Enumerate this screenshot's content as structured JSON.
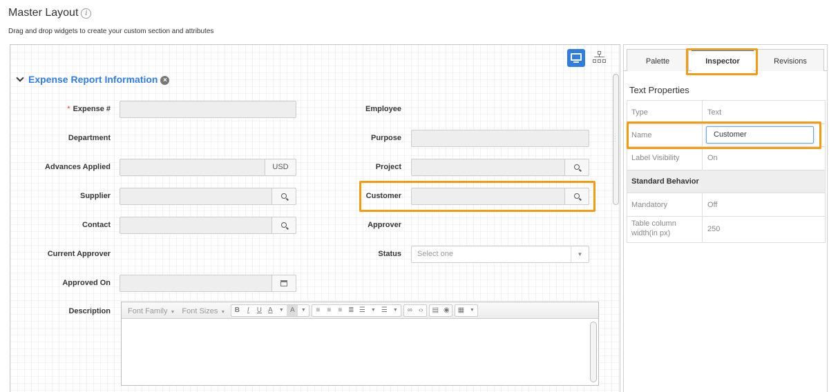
{
  "header": {
    "title": "Master Layout",
    "info_icon": "i",
    "subtitle": "Drag and drop widgets to create your custom section and attributes"
  },
  "canvas": {
    "view_toggles": [
      "desktop-icon",
      "hierarchy-icon"
    ],
    "section": {
      "title": "Expense Report Information",
      "remove_icon": "×"
    },
    "fields": {
      "expense": {
        "label": "Expense #",
        "required_mark": "*"
      },
      "employee": {
        "label": "Employee"
      },
      "department": {
        "label": "Department"
      },
      "purpose": {
        "label": "Purpose"
      },
      "advances": {
        "label": "Advances Applied",
        "addon": "USD"
      },
      "project": {
        "label": "Project"
      },
      "supplier": {
        "label": "Supplier"
      },
      "customer": {
        "label": "Customer"
      },
      "contact": {
        "label": "Contact"
      },
      "approver": {
        "label": "Approver"
      },
      "current_approver": {
        "label": "Current Approver"
      },
      "status": {
        "label": "Status",
        "placeholder": "Select one"
      },
      "approved_on": {
        "label": "Approved On"
      },
      "description": {
        "label": "Description"
      }
    },
    "editor_toolbar": {
      "font_family": "Font Family",
      "font_sizes": "Font Sizes",
      "bold": "B",
      "italic": "I",
      "underline": "U",
      "font_color": "A",
      "bg_color": "A"
    }
  },
  "panel": {
    "tabs": {
      "palette": "Palette",
      "inspector": "Inspector",
      "revisions": "Revisions"
    },
    "section_title": "Text Properties",
    "properties": {
      "type": {
        "key": "Type",
        "value": "Text"
      },
      "name": {
        "key": "Name",
        "value": "Customer"
      },
      "label_visibility": {
        "key": "Label Visibility",
        "value": "On"
      },
      "standard_behavior": "Standard Behavior",
      "mandatory": {
        "key": "Mandatory",
        "value": "Off"
      },
      "col_width": {
        "key_line1": "Table column",
        "key_line2": "width(in px)",
        "value": "250"
      }
    }
  },
  "colors": {
    "accent": "#2f7de1",
    "highlight": "#f39c12",
    "required": "#e33333"
  }
}
